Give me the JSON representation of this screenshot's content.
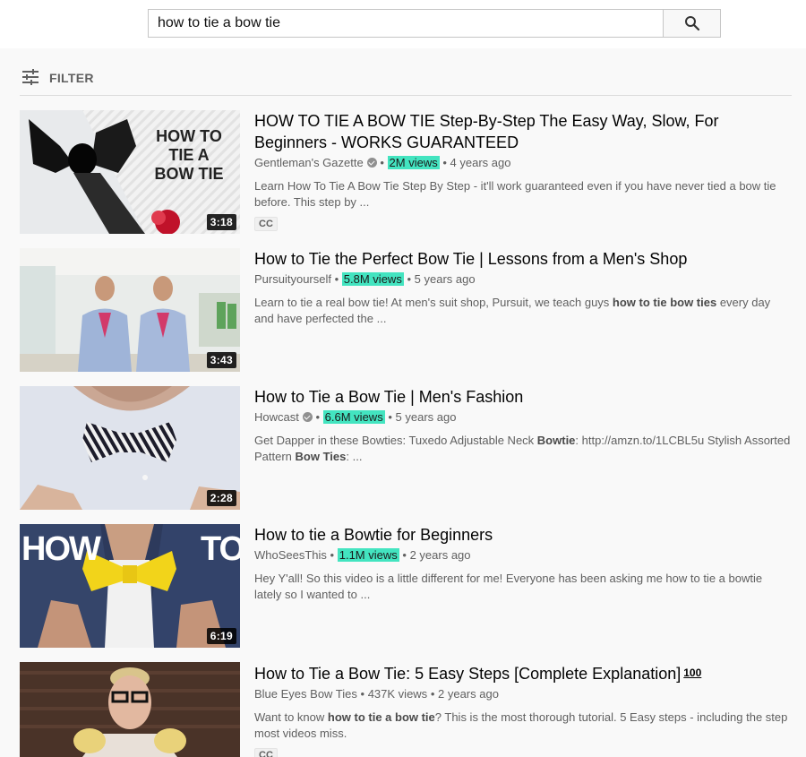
{
  "search": {
    "query": "how to tie a bow tie"
  },
  "filter": {
    "label": "FILTER"
  },
  "results": [
    {
      "title": "HOW TO TIE A BOW TIE Step-By-Step The Easy Way, Slow, For Beginners - WORKS GUARANTEED",
      "channel": "Gentleman's Gazette",
      "sep1": "•",
      "views": "2M views",
      "sep2": "•",
      "age": "4 years ago",
      "desc_1": "Learn How To Tie A Bow Tie Step By Step - it'll work guaranteed even if you have never tied a bow tie before. This step by ...",
      "duration": "3:18",
      "cc": "CC",
      "thumb_text_1": "HOW TO",
      "thumb_text_2": "TIE A",
      "thumb_text_3": "BOW TIE"
    },
    {
      "title": "How to Tie the Perfect Bow Tie | Lessons from a Men's Shop",
      "channel": "Pursuityourself",
      "sep1": "•",
      "views": "5.8M views",
      "sep2": "•",
      "age": "5 years ago",
      "desc_1": "Learn to tie a real bow tie! At men's suit shop, Pursuit, we teach guys ",
      "desc_b1": "how to tie bow ties",
      "desc_2": " every day and have perfected the ...",
      "duration": "3:43"
    },
    {
      "title": "How to Tie a Bow Tie | Men's Fashion",
      "channel": "Howcast",
      "sep1": "•",
      "views": "6.6M views",
      "sep2": "•",
      "age": "5 years ago",
      "desc_1": "Get Dapper in these Bowties: Tuxedo Adjustable Neck ",
      "desc_b1": "Bowtie",
      "desc_2": ": http://amzn.to/1LCBL5u Stylish Assorted Pattern ",
      "desc_b2": "Bow Ties",
      "desc_3": ": ...",
      "duration": "2:28"
    },
    {
      "title": "How to tie a Bowtie for Beginners",
      "channel": "WhoSeesThis",
      "sep1": "•",
      "views": "1.1M views",
      "sep2": "•",
      "age": "2 years ago",
      "desc_1": "Hey Y'all! So this video is a little different for me! Everyone has been asking me how to tie a bowtie lately so I wanted to ...",
      "duration": "6:19",
      "thumb_text_1": "HOW",
      "thumb_text_2": "TO"
    },
    {
      "title": "How to Tie a Bow Tie: 5 Easy Steps [Complete Explanation]",
      "badge": "100",
      "channel": "Blue Eyes Bow Ties",
      "sep1": "•",
      "views": "437K views",
      "sep2": "•",
      "age": "2 years ago",
      "desc_1": "Want to know ",
      "desc_b1": "how to tie a bow tie",
      "desc_2": "? This is the most thorough tutorial. 5 Easy steps - including the step most videos miss.",
      "cc": "CC"
    }
  ]
}
